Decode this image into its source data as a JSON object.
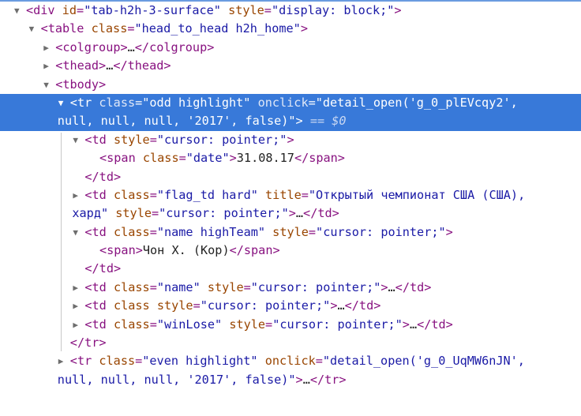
{
  "colors": {
    "tag": "#881280",
    "attribute": "#994500",
    "value": "#1a1aa6",
    "selection": "#3879d9"
  },
  "selected_suffix": "== $0",
  "nodes": [
    {
      "level": 0,
      "arrow": "down",
      "segs": [
        [
          "tag",
          "<div"
        ],
        [
          "sp",
          " "
        ],
        [
          "attr",
          "id"
        ],
        [
          "tag",
          "="
        ],
        [
          "val",
          "\"tab-h2h-3-surface\""
        ],
        [
          "sp",
          " "
        ],
        [
          "attr",
          "style"
        ],
        [
          "tag",
          "="
        ],
        [
          "val",
          "\"display: block;\""
        ],
        [
          "tag",
          ">"
        ]
      ]
    },
    {
      "level": 1,
      "arrow": "down",
      "segs": [
        [
          "tag",
          "<table"
        ],
        [
          "sp",
          " "
        ],
        [
          "attr",
          "class"
        ],
        [
          "tag",
          "="
        ],
        [
          "val",
          "\"head_to_head h2h_home\""
        ],
        [
          "tag",
          ">"
        ]
      ]
    },
    {
      "level": 2,
      "arrow": "right",
      "segs": [
        [
          "tag",
          "<colgroup>"
        ],
        [
          "txt",
          "…"
        ],
        [
          "tag",
          "</colgroup>"
        ]
      ]
    },
    {
      "level": 2,
      "arrow": "right",
      "segs": [
        [
          "tag",
          "<thead>"
        ],
        [
          "txt",
          "…"
        ],
        [
          "tag",
          "</thead>"
        ]
      ]
    },
    {
      "level": 2,
      "arrow": "down",
      "segs": [
        [
          "tag",
          "<tbody>"
        ]
      ]
    },
    {
      "level": 3,
      "arrow": "down",
      "selected": true,
      "segs": [
        [
          "tag",
          "<tr"
        ],
        [
          "sp",
          " "
        ],
        [
          "attr",
          "class"
        ],
        [
          "tag",
          "="
        ],
        [
          "val",
          "\"odd highlight\""
        ],
        [
          "sp",
          " "
        ],
        [
          "attr",
          "onclick"
        ],
        [
          "tag",
          "="
        ],
        [
          "val",
          "\"detail_open('g_0_plEVcqy2',"
        ],
        [
          "br",
          ""
        ],
        [
          "val",
          "null, null, null, '2017', false)\""
        ],
        [
          "tag",
          ">"
        ]
      ]
    },
    {
      "level": 4,
      "arrow": "down",
      "segs": [
        [
          "tag",
          "<td"
        ],
        [
          "sp",
          " "
        ],
        [
          "attr",
          "style"
        ],
        [
          "tag",
          "="
        ],
        [
          "val",
          "\"cursor: pointer;\""
        ],
        [
          "tag",
          ">"
        ]
      ]
    },
    {
      "level": 5,
      "arrow": "none",
      "segs": [
        [
          "tag",
          "<span"
        ],
        [
          "sp",
          " "
        ],
        [
          "attr",
          "class"
        ],
        [
          "tag",
          "="
        ],
        [
          "val",
          "\"date\""
        ],
        [
          "tag",
          ">"
        ],
        [
          "txt",
          "31.08.17"
        ],
        [
          "tag",
          "</span>"
        ]
      ]
    },
    {
      "level": 4,
      "arrow": "none",
      "segs": [
        [
          "tag",
          "</td>"
        ]
      ]
    },
    {
      "level": 4,
      "arrow": "right",
      "segs": [
        [
          "tag",
          "<td"
        ],
        [
          "sp",
          " "
        ],
        [
          "attr",
          "class"
        ],
        [
          "tag",
          "="
        ],
        [
          "val",
          "\"flag_td hard\""
        ],
        [
          "sp",
          " "
        ],
        [
          "attr",
          "title"
        ],
        [
          "tag",
          "="
        ],
        [
          "val",
          "\"Открытый чемпионат США (США),"
        ],
        [
          "br",
          ""
        ],
        [
          "val",
          "хард\""
        ],
        [
          "sp",
          " "
        ],
        [
          "attr",
          "style"
        ],
        [
          "tag",
          "="
        ],
        [
          "val",
          "\"cursor: pointer;\""
        ],
        [
          "tag",
          ">"
        ],
        [
          "txt",
          "…"
        ],
        [
          "tag",
          "</td>"
        ]
      ]
    },
    {
      "level": 4,
      "arrow": "down",
      "segs": [
        [
          "tag",
          "<td"
        ],
        [
          "sp",
          " "
        ],
        [
          "attr",
          "class"
        ],
        [
          "tag",
          "="
        ],
        [
          "val",
          "\"name highTeam\""
        ],
        [
          "sp",
          " "
        ],
        [
          "attr",
          "style"
        ],
        [
          "tag",
          "="
        ],
        [
          "val",
          "\"cursor: pointer;\""
        ],
        [
          "tag",
          ">"
        ]
      ]
    },
    {
      "level": 5,
      "arrow": "none",
      "segs": [
        [
          "tag",
          "<span>"
        ],
        [
          "txt",
          "Чон Х. (Кор)"
        ],
        [
          "tag",
          "</span>"
        ]
      ]
    },
    {
      "level": 4,
      "arrow": "none",
      "segs": [
        [
          "tag",
          "</td>"
        ]
      ]
    },
    {
      "level": 4,
      "arrow": "right",
      "segs": [
        [
          "tag",
          "<td"
        ],
        [
          "sp",
          " "
        ],
        [
          "attr",
          "class"
        ],
        [
          "tag",
          "="
        ],
        [
          "val",
          "\"name\""
        ],
        [
          "sp",
          " "
        ],
        [
          "attr",
          "style"
        ],
        [
          "tag",
          "="
        ],
        [
          "val",
          "\"cursor: pointer;\""
        ],
        [
          "tag",
          ">"
        ],
        [
          "txt",
          "…"
        ],
        [
          "tag",
          "</td>"
        ]
      ]
    },
    {
      "level": 4,
      "arrow": "right",
      "segs": [
        [
          "tag",
          "<td"
        ],
        [
          "sp",
          " "
        ],
        [
          "attr",
          "class"
        ],
        [
          "sp",
          " "
        ],
        [
          "attr",
          "style"
        ],
        [
          "tag",
          "="
        ],
        [
          "val",
          "\"cursor: pointer;\""
        ],
        [
          "tag",
          ">"
        ],
        [
          "txt",
          "…"
        ],
        [
          "tag",
          "</td>"
        ]
      ]
    },
    {
      "level": 4,
      "arrow": "right",
      "segs": [
        [
          "tag",
          "<td"
        ],
        [
          "sp",
          " "
        ],
        [
          "attr",
          "class"
        ],
        [
          "tag",
          "="
        ],
        [
          "val",
          "\"winLose\""
        ],
        [
          "sp",
          " "
        ],
        [
          "attr",
          "style"
        ],
        [
          "tag",
          "="
        ],
        [
          "val",
          "\"cursor: pointer;\""
        ],
        [
          "tag",
          ">"
        ],
        [
          "txt",
          "…"
        ],
        [
          "tag",
          "</td>"
        ]
      ]
    },
    {
      "level": 3,
      "arrow": "none",
      "segs": [
        [
          "tag",
          "</tr>"
        ]
      ]
    },
    {
      "level": 3,
      "arrow": "right",
      "segs": [
        [
          "tag",
          "<tr"
        ],
        [
          "sp",
          " "
        ],
        [
          "attr",
          "class"
        ],
        [
          "tag",
          "="
        ],
        [
          "val",
          "\"even highlight\""
        ],
        [
          "sp",
          " "
        ],
        [
          "attr",
          "onclick"
        ],
        [
          "tag",
          "="
        ],
        [
          "val",
          "\"detail_open('g_0_UqMW6nJN',"
        ],
        [
          "br",
          ""
        ],
        [
          "val",
          "null, null, null, '2017', false)\""
        ],
        [
          "tag",
          ">"
        ],
        [
          "txt",
          "…"
        ],
        [
          "tag",
          "</tr>"
        ]
      ]
    }
  ]
}
